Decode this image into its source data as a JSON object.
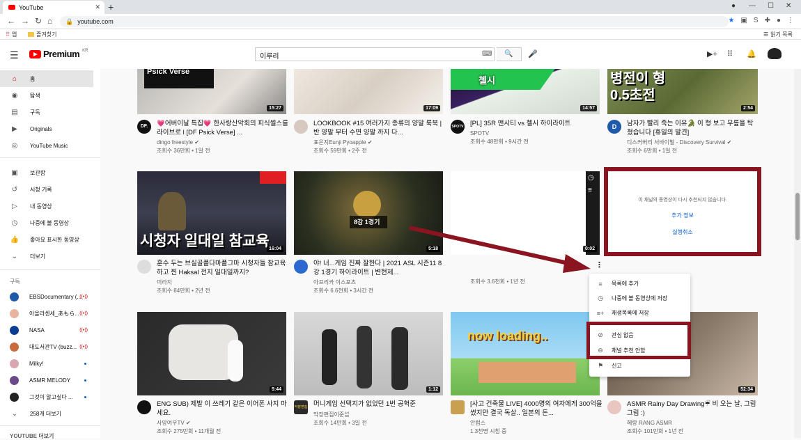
{
  "browser": {
    "tab_title": "YouTube",
    "url": "youtube.com",
    "bookmarks": [
      {
        "label": "앱"
      },
      {
        "label": "즐겨찾기"
      }
    ],
    "reading_list": "읽기 목록"
  },
  "header": {
    "logo_text": "Premium",
    "logo_region": "KR",
    "search_value": "이루리"
  },
  "sidebar": {
    "items": [
      {
        "label": "홈",
        "icon": "home-icon",
        "active": true
      },
      {
        "label": "탐색",
        "icon": "compass-icon"
      },
      {
        "label": "구독",
        "icon": "subscriptions-icon"
      },
      {
        "label": "Originals",
        "icon": "originals-icon"
      },
      {
        "label": "YouTube Music",
        "icon": "music-icon"
      },
      {
        "label": "보관함",
        "icon": "library-icon"
      },
      {
        "label": "시청 기록",
        "icon": "history-icon"
      },
      {
        "label": "내 동영상",
        "icon": "my-videos-icon"
      },
      {
        "label": "나중에 볼 동영상",
        "icon": "watch-later-icon"
      },
      {
        "label": "좋아요 표시한 동영상",
        "icon": "thumbs-up-icon"
      },
      {
        "label": "더보기",
        "icon": "chevron-down-icon"
      }
    ],
    "subscriptions_heading": "구독",
    "subscriptions": [
      {
        "label": "EBSDocumentary (...",
        "color": "#1e5aa8",
        "status": "live"
      },
      {
        "label": "아올라센세_あもら...",
        "color": "#e8b4a0",
        "status": "live"
      },
      {
        "label": "NASA",
        "color": "#0b3d91",
        "status": "live"
      },
      {
        "label": "대도서관TV (buzz...",
        "color": "#c86b3c",
        "status": "live"
      },
      {
        "label": "Milky!",
        "color": "#d9a7b0",
        "status": "dot"
      },
      {
        "label": "ASMR MELODY",
        "color": "#6b4a8a",
        "status": "dot"
      },
      {
        "label": "그것이 알고싶다 ...",
        "color": "#222222",
        "status": "dot"
      },
      {
        "label": "258개 더보기",
        "color": "",
        "status": ""
      }
    ],
    "footer_heading": "YOUTUBE 더보기"
  },
  "videos": [
    {
      "title": "💗어버이날 특집💗 한사랑산악회의 피식썰스를 라이브로 l [DF Psick Verse] ...",
      "channel": "dingo freestyle",
      "verified": true,
      "meta": "조회수 36만회 • 1일 전",
      "duration": "15:27",
      "overlay": "Psick Verse",
      "avatar_text": "DF."
    },
    {
      "title": "LOOKBOOK #15 여러가지 종류의 양말 룩북 | 반 양말 부터 수면 양말 까지 다...",
      "channel": "표은지Eunji Pyoapple",
      "verified": true,
      "meta": "조회수 59만회 • 2주 전",
      "duration": "17:09",
      "overlay": "",
      "avatar_text": ""
    },
    {
      "title": "[PL] 35R 맨시티 vs 첼시 하이라이트",
      "channel": "SPOTV",
      "verified": false,
      "meta": "조회수 48만회 • 9시간 전",
      "duration": "14:57",
      "overlay": "첼시",
      "avatar_text": "SPOTV"
    },
    {
      "title": "남자가 빨리 죽는 이유🐊 이 형 보고 무릎을 탁 쳤습니다 [휴일의 발견]",
      "channel": "디스커버리 서바이벌 - Discovery Survival",
      "verified": true,
      "meta": "조회수 6만회 • 1일 전",
      "duration": "2:54",
      "overlay": "병전이 형 0.5초전",
      "avatar_text": "D"
    },
    {
      "title": "훈수 두는 브실골플다마플그마 시청자들 참교육 하고 찐 Haksal 전지 일대일까지?",
      "channel": "미라지",
      "verified": false,
      "meta": "조회수 84만회 • 2년 전",
      "duration": "16:04",
      "overlay": "시청자 일대일 참교육",
      "avatar_text": ""
    },
    {
      "title": "야! 너...게임 진짜 잘한다 | 2021 ASL 시즌11 8강 1경기 하이라이트 | 변현제...",
      "channel": "아프리카 이스포츠",
      "verified": false,
      "meta": "조회수 6.6천회 • 3시간 전",
      "duration": "5:18",
      "overlay": "8강 1경기",
      "avatar_text": ""
    },
    {
      "title": "",
      "channel": "",
      "verified": false,
      "meta": "조회수 3.6천회 • 1년 전",
      "duration": "0:02",
      "overlay": "",
      "avatar_text": ""
    },
    {
      "title": "ENG SUB) 제발 이 쓰레기 같은 이어폰 사지 마세요.",
      "channel": "사망여우TV",
      "verified": true,
      "meta": "조회수 275만회 • 11개월 전",
      "duration": "5:44",
      "overlay": "",
      "avatar_text": ""
    },
    {
      "title": "머니게임 선택지가 없었던 1번 공혁준",
      "channel": "막장편집이준섭",
      "verified": false,
      "meta": "조회수 14만회 • 3일 전",
      "duration": "1:12",
      "overlay": "",
      "avatar_text": "막장편집"
    },
    {
      "title": "[사고 건축물 LIVE] 4000명의 여자에게 300억을 썼지만 결국 독살.. 일본의 돈...",
      "channel": "안럽스",
      "verified": false,
      "meta": "1.3천명 시청 중",
      "duration": "",
      "overlay": "now loading..",
      "avatar_text": ""
    },
    {
      "title": "ASMR Rainy Day Drawing☔ 비 오는 날, 그림 그림 :)",
      "channel": "혜랑 RANG ASMR",
      "verified": false,
      "meta": "조회수 101만회 • 1년 전",
      "duration": "52:34",
      "overlay": "",
      "avatar_text": ""
    }
  ],
  "removed_card": {
    "message": "이 채널의 동영상이 다시 추천되지 않습니다.",
    "more_info": "추가 정보",
    "undo": "실행취소"
  },
  "context_menu": [
    {
      "label": "목록에 추가",
      "icon": "add-to-queue-icon"
    },
    {
      "label": "나중에 볼 동영상에 저장",
      "icon": "clock-icon"
    },
    {
      "label": "재생목록에 저장",
      "icon": "playlist-add-icon"
    },
    {
      "label": "관심 없음",
      "icon": "block-icon"
    },
    {
      "label": "채널 추천 안함",
      "icon": "minus-circle-icon"
    },
    {
      "label": "신고",
      "icon": "flag-icon"
    }
  ],
  "colors": {
    "highlight": "#8b1421",
    "link": "#065fd4",
    "brand": "#ff0000"
  }
}
